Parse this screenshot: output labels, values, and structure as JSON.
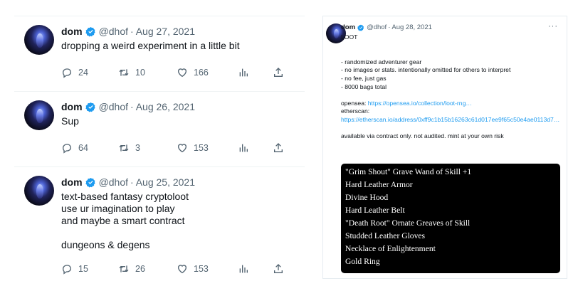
{
  "colors": {
    "accent": "#1d9bf0",
    "muted": "#536471",
    "text": "#0f1419",
    "verified": "#1d9bf0"
  },
  "left_tweets": [
    {
      "name": "dom",
      "handle": "@dhof",
      "dot": "·",
      "date": "Aug 27, 2021",
      "lines": [
        "dropping a weird experiment in a little bit"
      ],
      "replies": "24",
      "retweets": "10",
      "likes": "166"
    },
    {
      "name": "dom",
      "handle": "@dhof",
      "dot": "·",
      "date": "Aug 26, 2021",
      "lines": [
        "Sup"
      ],
      "replies": "64",
      "retweets": "3",
      "likes": "153"
    },
    {
      "name": "dom",
      "handle": "@dhof",
      "dot": "·",
      "date": "Aug 25, 2021",
      "lines": [
        "text-based fantasy cryptoloot",
        "use ur imagination to play",
        "and maybe a smart contract",
        "",
        "dungeons & degens"
      ],
      "replies": "15",
      "retweets": "26",
      "likes": "153"
    }
  ],
  "card": {
    "name": "dom",
    "handle": "@dhof",
    "dot": "·",
    "date": "Aug 28, 2021",
    "more": "···",
    "title": "LOOT",
    "bullets": [
      "- randomized adventurer gear",
      "- no images or stats. intentionally omitted for others to interpret",
      "- no fee, just gas",
      "- 8000 bags total"
    ],
    "opensea_label": "opensea:",
    "opensea_link": "https://opensea.io/collection/loot-rng…",
    "etherscan_label": "etherscan:",
    "etherscan_link": "https://etherscan.io/address/0xff9c1b15b16263c61d017ee9f65c50e4ae0113d7…",
    "availability": "available via contract only. not audited. mint at your own risk",
    "loot_items": [
      "\"Grim Shout\" Grave Wand of Skill +1",
      "Hard Leather Armor",
      "Divine Hood",
      "Hard Leather Belt",
      "\"Death Root\" Ornate Greaves of Skill",
      "Studded Leather Gloves",
      "Necklace of Enlightenment",
      "Gold Ring"
    ]
  }
}
